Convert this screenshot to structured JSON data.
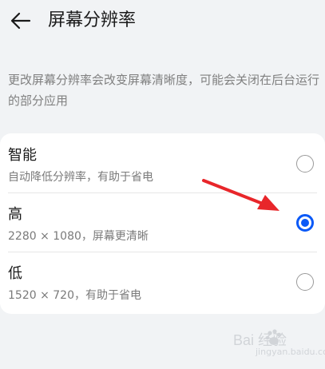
{
  "header": {
    "title": "屏幕分辨率",
    "back_icon": "back-arrow-icon"
  },
  "description": "更改屏幕分辨率会改变屏幕清晰度，可能会关闭在后台运行的部分应用",
  "options": [
    {
      "title": "智能",
      "subtitle": "自动降低分辨率，有助于省电",
      "selected": false
    },
    {
      "title": "高",
      "subtitle": "2280 × 1080，屏幕更清晰",
      "selected": true
    },
    {
      "title": "低",
      "subtitle": "1520 × 720，有助于省电",
      "selected": false
    }
  ],
  "colors": {
    "accent": "#0a59f7",
    "annotation_arrow": "#e8262a"
  },
  "watermark": {
    "brand": "Bai 经验",
    "site": "jingyan.baidu.com"
  }
}
